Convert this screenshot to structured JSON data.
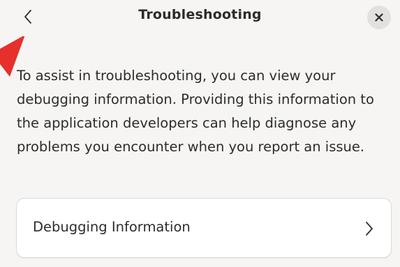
{
  "header": {
    "back_icon": "chevron-left-icon",
    "title": "Troubleshooting",
    "close_icon": "close-icon"
  },
  "description": "To assist in troubleshooting, you can view your debugging information. Providing this information to the application developers can help diagnose any problems you encounter when you report an issue.",
  "rows": [
    {
      "label": "Debugging Information",
      "icon": "chevron-right-icon"
    }
  ],
  "colors": {
    "background": "#f6f5f4",
    "row_background": "#ffffff",
    "close_button_background": "#e3e1df",
    "annotation_pointer": "#e5302b"
  }
}
